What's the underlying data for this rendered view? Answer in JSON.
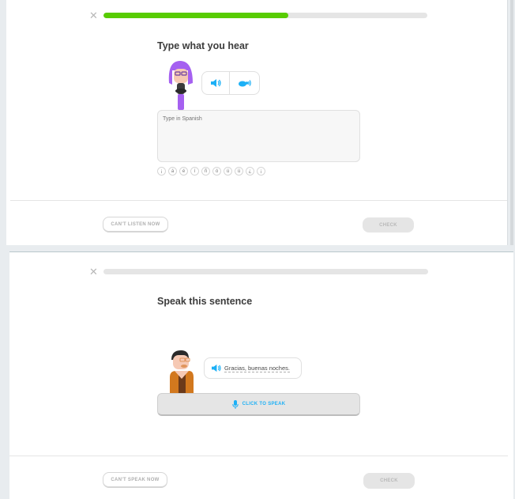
{
  "listen_challenge": {
    "progress_fraction": 0.57,
    "close_icon": "close-icon",
    "title": "Type what you hear",
    "speaker_icon": "speaker-icon",
    "slow_speaker_icon": "turtle-speaker-icon",
    "input_placeholder": "Type in Spanish",
    "special_chars": [
      "¡",
      "á",
      "é",
      "í",
      "ñ",
      "ó",
      "ú",
      "ü",
      "¿",
      "¡"
    ],
    "skip_label": "CAN'T LISTEN NOW",
    "check_label": "CHECK"
  },
  "speak_challenge": {
    "progress_fraction": 0.0,
    "close_icon": "close-icon",
    "title": "Speak this sentence",
    "sentence": "Gracias, buenas noches.",
    "mic_icon": "microphone-icon",
    "speak_label": "CLICK TO SPEAK",
    "skip_label": "CAN'T SPEAK NOW",
    "check_label": "CHECK"
  },
  "colors": {
    "progress_green": "#58cc02",
    "accent_blue": "#1cb0f6",
    "character_purple": "#a560f0"
  }
}
